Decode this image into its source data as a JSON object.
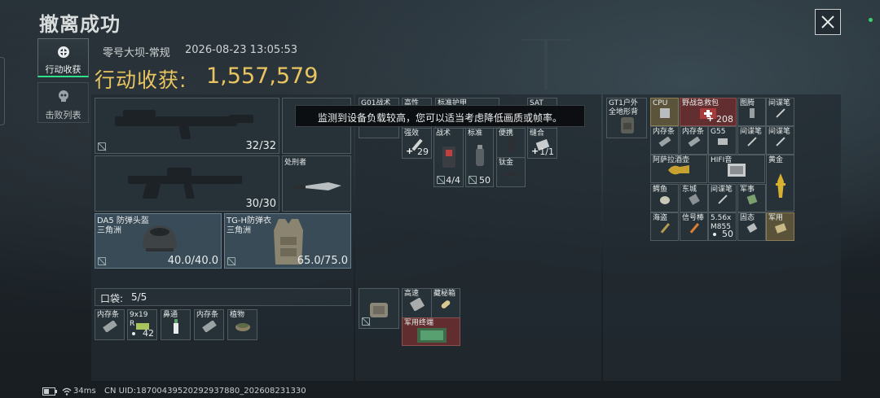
{
  "header": {
    "title": "撤离成功"
  },
  "close": {
    "label": "✕"
  },
  "nav": {
    "tabs": [
      {
        "label": "行动收获",
        "icon": "target-icon",
        "active": true
      },
      {
        "label": "击败列表",
        "icon": "skull-icon",
        "active": false
      }
    ]
  },
  "meta": {
    "map": "零号大坝-常规",
    "datetime": "2026-08-23 13:05:53"
  },
  "value": {
    "label": "行动收获:",
    "amount": "1,557,579"
  },
  "toast": {
    "text": "监测到设备负载较高，您可以适当考虑降低画质或帧率。"
  },
  "gear": {
    "primary": {
      "ammo": "32/32"
    },
    "secondary": {
      "ammo": "30/30"
    },
    "melee": {
      "name": "处刑者"
    },
    "helmet": {
      "name": "DA5 防弹头盔",
      "origin": "三角洲",
      "durability": "40.0/40.0"
    },
    "armor": {
      "name": "TG-H防弹衣",
      "origin": "三角洲",
      "durability": "65.0/75.0"
    }
  },
  "pockets": {
    "label": "口袋:",
    "count": "5/5",
    "items": [
      {
        "name": "内存条"
      },
      {
        "name": "9x19",
        "name2": "R",
        "count": "42"
      },
      {
        "name": "鼻通"
      },
      {
        "name": "内存条"
      },
      {
        "name": "植物"
      }
    ]
  },
  "rig": {
    "labels": {
      "a": "G01战术",
      "b": "高性",
      "c": "标准护甲",
      "d": "SAT"
    },
    "items": [
      {
        "name": "强效",
        "count": "29"
      },
      {
        "name": "战术",
        "count": "4/4"
      },
      {
        "name": "标准",
        "count": "50"
      },
      {
        "name": "便携"
      },
      {
        "name": "钛金"
      },
      {
        "name": "缝合",
        "count": "1/1"
      }
    ]
  },
  "pouch": {
    "items": [
      {
        "name": "高速"
      },
      {
        "name": "藏秘箱"
      },
      {
        "name": "军用终端"
      }
    ]
  },
  "backpack": {
    "container": {
      "name": "GT1户外",
      "name2": "全地形背"
    },
    "items": [
      {
        "name": "CPU"
      },
      {
        "name": "野战急救包",
        "count": "208"
      },
      {
        "name": "图腾"
      },
      {
        "name": "间谍笔"
      },
      {
        "name": "内存条"
      },
      {
        "name": "内存条"
      },
      {
        "name": "G55"
      },
      {
        "name": "间谍笔"
      },
      {
        "name": "间谍笔"
      },
      {
        "name": "阿萨拉酒壶"
      },
      {
        "name": "HIFI音"
      },
      {
        "name": "黄金"
      },
      {
        "name": "鳄鱼"
      },
      {
        "name": "东城"
      },
      {
        "name": "间谍笔"
      },
      {
        "name": "军事"
      },
      {
        "name": "海盗"
      },
      {
        "name": "信号棒"
      },
      {
        "name": "5.56x",
        "name2": "M855",
        "count": "50"
      },
      {
        "name": "固态"
      },
      {
        "name": "军用"
      }
    ]
  },
  "status": {
    "ping": "34ms",
    "uid": "CN UID:187004395202929378​80_202608231330"
  }
}
